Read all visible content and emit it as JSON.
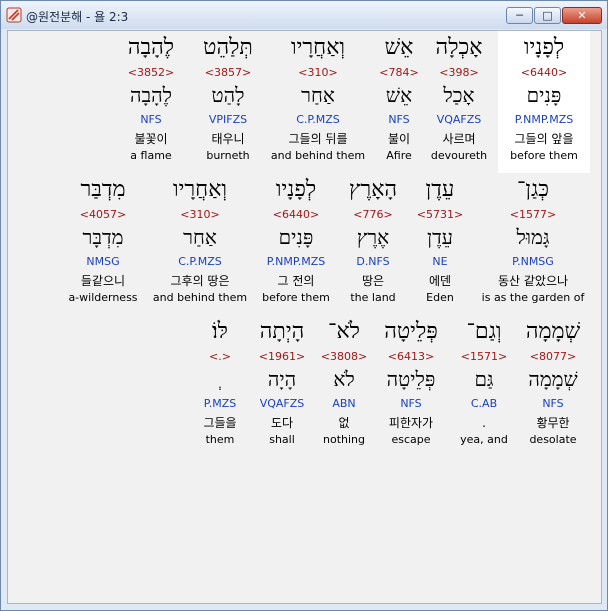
{
  "window": {
    "title": "@원전분해 - 욜 2:3",
    "minimize_label": "─",
    "maximize_label": "□",
    "close_label": "✕"
  },
  "rows": [
    {
      "words": [
        {
          "hebrew": "לְפָנָיו",
          "strong": "<6440>",
          "lemma": "פָּנִים",
          "parse": "P.NMP.MZS",
          "korean": "그들의 앞을",
          "english": "before them",
          "highlight": true
        },
        {
          "hebrew": "אָכְלָה",
          "strong": "<398>",
          "lemma": "אָכַל",
          "parse": "VQAFZS",
          "korean": "사르며",
          "english": "devoureth"
        },
        {
          "hebrew": "אֵשׁ",
          "strong": "<784>",
          "lemma": "אֵשׁ",
          "parse": "NFS",
          "korean": "불이",
          "english": "Afire"
        },
        {
          "hebrew": "וְאַחֲרָיו",
          "strong": "<310>",
          "lemma": "אַחַר",
          "parse": "C.P.MZS",
          "korean": "그들의 뒤를",
          "english": "and behind them"
        },
        {
          "hebrew": "תְּלַהֵט",
          "strong": "<3857>",
          "lemma": "לָהַט",
          "parse": "VPIFZS",
          "korean": "태우니",
          "english": "burneth"
        },
        {
          "hebrew": "לֶהָבָה",
          "strong": "<3852>",
          "lemma": "לֶהָבָה",
          "parse": "NFS",
          "korean": "불꽃이",
          "english": "a flame"
        }
      ]
    },
    {
      "words": [
        {
          "hebrew": "כְּגַן־",
          "strong": "<1577>",
          "lemma": "גָּמוּל",
          "parse": "P.NMSG",
          "korean": "동산 같았으나",
          "english": "is as the garden of"
        },
        {
          "hebrew": "עֵדֶן",
          "strong": "<5731>",
          "lemma": "עֵדֶן",
          "parse": "NE",
          "korean": "에덴",
          "english": "Eden"
        },
        {
          "hebrew": "הָאָרֶץ",
          "strong": "<776>",
          "lemma": "אֶרֶץ",
          "parse": "D.NFS",
          "korean": "땅은",
          "english": "the land"
        },
        {
          "hebrew": "לְפָנָיו",
          "strong": "<6440>",
          "lemma": "פָּנִים",
          "parse": "P.NMP.MZS",
          "korean": "그 전의",
          "english": "before them"
        },
        {
          "hebrew": "וְאַחֲרָיו",
          "strong": "<310>",
          "lemma": "אַחַר",
          "parse": "C.P.MZS",
          "korean": "그후의 땅은",
          "english": "and behind them"
        },
        {
          "hebrew": "מִדְבַּר",
          "strong": "<4057>",
          "lemma": "מִדְבָּר",
          "parse": "NMSG",
          "korean": "들같으니",
          "english": "a-wilderness"
        }
      ]
    },
    {
      "words": [
        {
          "hebrew": "שְׁמָמָה",
          "strong": "<8077>",
          "lemma": "שְׁמָמָה",
          "parse": "NFS",
          "korean": "황무한",
          "english": "desolate"
        },
        {
          "hebrew": "וְגַם־",
          "strong": "<1571>",
          "lemma": "גַּם",
          "parse": "C.AB",
          "korean": ".",
          "english": "yea, and"
        },
        {
          "hebrew": "פְּלֵיטָה",
          "strong": "<6413>",
          "lemma": "פְּלֵיטָה",
          "parse": "NFS",
          "korean": "피한자가",
          "english": "escape"
        },
        {
          "hebrew": "לֹא־",
          "strong": "<3808>",
          "lemma": "לֹא",
          "parse": "ABN",
          "korean": "없",
          "english": "nothing"
        },
        {
          "hebrew": "הָיְתָה",
          "strong": "<1961>",
          "lemma": "הָיָה",
          "parse": "VQAFZS",
          "korean": "도다",
          "english": "shall"
        },
        {
          "hebrew": "לּוֹ׃",
          "strong": "<.>",
          "lemma": "ְ",
          "parse": "P.MZS",
          "korean": "그들을",
          "english": "them"
        }
      ]
    }
  ]
}
